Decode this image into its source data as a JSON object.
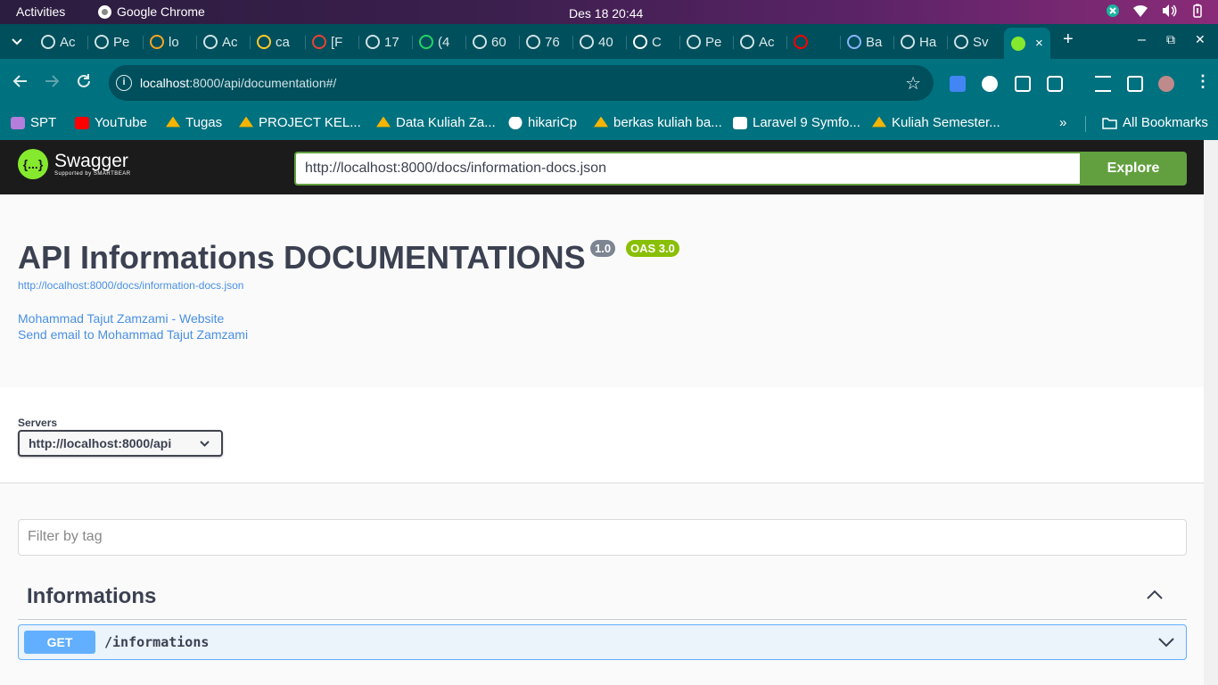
{
  "system": {
    "activities": "Activities",
    "app_name": "Google Chrome",
    "clock": "Des 18  20:44"
  },
  "tabs": [
    {
      "label": "Ac",
      "icon": "loading-circle-icon",
      "color": "#cfe3e6"
    },
    {
      "label": "Pe",
      "icon": "link-icon",
      "color": "#cfe3e6"
    },
    {
      "label": "lo",
      "icon": "laravel-icon",
      "color": "#f5a623"
    },
    {
      "label": "Ac",
      "icon": "link-icon",
      "color": "#cfe3e6"
    },
    {
      "label": "ca",
      "icon": "firebase-icon",
      "color": "#ffca28"
    },
    {
      "label": "[F",
      "icon": "gmail-icon",
      "color": "#ea4335"
    },
    {
      "label": "17",
      "icon": "gear-icon",
      "color": "#cfe3e6"
    },
    {
      "label": "(4",
      "icon": "whatsapp-icon",
      "color": "#25d366"
    },
    {
      "label": "60",
      "icon": "gear-icon",
      "color": "#cfe3e6"
    },
    {
      "label": "76",
      "icon": "gear-icon",
      "color": "#cfe3e6"
    },
    {
      "label": "40",
      "icon": "gear-icon",
      "color": "#cfe3e6"
    },
    {
      "label": "C",
      "icon": "codepen-icon",
      "color": "#fff"
    },
    {
      "label": "Pe",
      "icon": "loading-circle-icon",
      "color": "#cfe3e6"
    },
    {
      "label": "Ac",
      "icon": "link-icon",
      "color": "#cfe3e6"
    },
    {
      "label": "",
      "icon": "youtube-icon",
      "color": "#ff0000"
    },
    {
      "label": "Ba",
      "icon": "gemini-icon",
      "color": "#8ab4f8"
    },
    {
      "label": "Ha",
      "icon": "link-icon",
      "color": "#cfe3e6"
    },
    {
      "label": "Sv",
      "icon": "globe-icon",
      "color": "#cfe3e6"
    }
  ],
  "active_tab": {
    "icon": "swagger-icon",
    "close": "×"
  },
  "new_tab": "+",
  "window_controls": {
    "minimize": "–",
    "maximize": "⧉",
    "close": "✕"
  },
  "address": {
    "host": "localhost",
    "path": ":8000/api/documentation#/"
  },
  "bookmarks": [
    {
      "label": "SPT",
      "icon": "spt-icon",
      "color": "#b57edc"
    },
    {
      "label": "YouTube",
      "icon": "youtube-icon",
      "color": "#ff0000"
    },
    {
      "label": "Tugas",
      "icon": "drive-icon",
      "color": "#f4b400"
    },
    {
      "label": "PROJECT KEL...",
      "icon": "drive-icon",
      "color": "#f4b400"
    },
    {
      "label": "Data Kuliah Za...",
      "icon": "drive-icon",
      "color": "#f4b400"
    },
    {
      "label": "hikariCp",
      "icon": "github-icon",
      "color": "#ffffff"
    },
    {
      "label": "berkas kuliah ba...",
      "icon": "drive-icon",
      "color": "#f4b400"
    },
    {
      "label": "Laravel 9 Symfo...",
      "icon": "send-icon",
      "color": "#ffffff"
    },
    {
      "label": "Kuliah Semester...",
      "icon": "drive-icon",
      "color": "#f4b400"
    }
  ],
  "bookmarks_more": "»",
  "all_bookmarks": "All Bookmarks",
  "swagger": {
    "logo_text": "Swagger",
    "logo_sub": "Supported by SMARTBEAR",
    "logo_mark": "{...}",
    "spec_url": "http://localhost:8000/docs/information-docs.json",
    "explore": "Explore",
    "title": "API Informations DOCUMENTATIONS",
    "version": "1.0",
    "oas": "OAS 3.0",
    "spec_link": "http://localhost:8000/docs/information-docs.json",
    "contact_website": "Mohammad Tajut Zamzami - Website",
    "contact_email": "Send email to Mohammad Tajut Zamzami",
    "servers_label": "Servers",
    "server_selected": "http://localhost:8000/api",
    "filter_placeholder": "Filter by tag",
    "tag_name": "Informations",
    "operation": {
      "method": "GET",
      "path": "/informations"
    }
  },
  "colors": {
    "accent_green": "#62a03f",
    "get_blue": "#61affe",
    "chrome_teal": "#00717f"
  }
}
